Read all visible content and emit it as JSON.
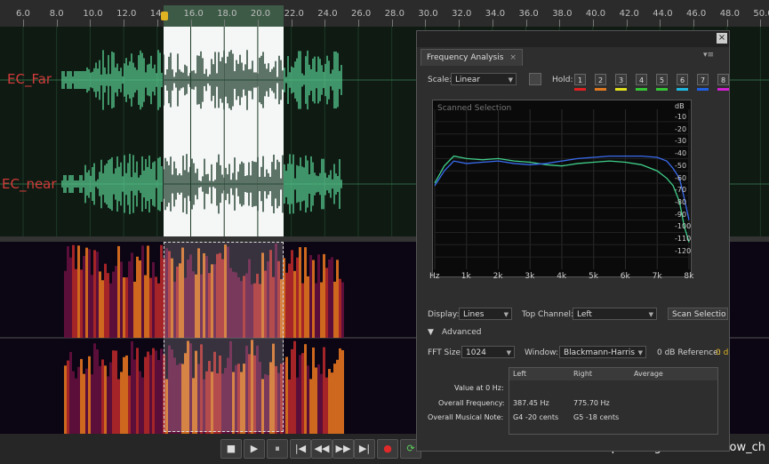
{
  "timeline": {
    "ticks": [
      "6.0",
      "8.0",
      "10.0",
      "12.0",
      "14",
      "16.0",
      "18.0",
      "20.0",
      "22.0",
      "24.0",
      "26.0",
      "28.0",
      "30.0",
      "32.0",
      "34.0",
      "36.0",
      "38.0",
      "40.0",
      "42.0",
      "44.0",
      "46.0",
      "48.0",
      "50.0"
    ]
  },
  "tracks": [
    {
      "label": "EC_Far"
    },
    {
      "label": "EC_near"
    }
  ],
  "colors": {
    "waveform": "#56c98f",
    "selection": "#f4f7f6",
    "label_red": "#d23b3b",
    "playhead": "#e0b323"
  },
  "panel": {
    "tab_title": "Frequency Analysis",
    "tab_close": "×",
    "close_icon": "×",
    "menu_icon": "▾≡",
    "scale_label": "Scale:",
    "scale_value": "Linear",
    "hold_label": "Hold:",
    "hold_buttons": [
      "1",
      "2",
      "3",
      "4",
      "5",
      "6",
      "7",
      "8"
    ],
    "hold_colors": [
      "#e02020",
      "#e07a20",
      "#e0e020",
      "#36c436",
      "#36c436",
      "#20b8e0",
      "#2060e0",
      "#d020d0"
    ],
    "graph_caption": "Scanned Selection",
    "db_unit": "dB",
    "db_ticks": [
      "-10",
      "-20",
      "-30",
      "-40",
      "-50",
      "-60",
      "-70",
      "-80",
      "-90",
      "-100",
      "-110",
      "-120"
    ],
    "freq_ticks": [
      "Hz",
      "1k",
      "2k",
      "3k",
      "4k",
      "5k",
      "6k",
      "7k",
      "8k"
    ],
    "display_label": "Display:",
    "display_value": "Lines",
    "top_channel_label": "Top Channel:",
    "top_channel_value": "Left",
    "scan_button": "Scan Selectio",
    "advanced_label": "Advanced",
    "fft_label": "FFT Size:",
    "fft_value": "1024",
    "window_label": "Window:",
    "window_value": "Blackmann-Harris",
    "zero_db_label": "0 dB Reference:",
    "zero_db_value": "0 d",
    "table": {
      "headers": [
        "Left",
        "Right",
        "Average"
      ],
      "rows": [
        {
          "label": "Value at 0 Hz:",
          "left": "",
          "right": ""
        },
        {
          "label": "Overall Frequency:",
          "left": "387.45 Hz",
          "right": "775.70 Hz"
        },
        {
          "label": "Overall Musical Note:",
          "left": "G4 -20 cents",
          "right": "G5 -18 cents"
        }
      ]
    }
  },
  "chart_data": {
    "type": "line",
    "title": "Scanned Selection",
    "xlabel": "",
    "ylabel": "dB",
    "xlim": [
      0,
      8000
    ],
    "ylim": [
      -130,
      0
    ],
    "x": [
      0,
      300,
      600,
      1000,
      1500,
      2000,
      2500,
      3000,
      3500,
      4000,
      4500,
      5000,
      5500,
      6000,
      6500,
      7000,
      7300,
      7500,
      7700,
      7850,
      8000
    ],
    "series": [
      {
        "color": "#3fd08a",
        "values": [
          -60,
          -46,
          -38,
          -40,
          -41,
          -40,
          -42,
          -43,
          -45,
          -46,
          -44,
          -43,
          -42,
          -43,
          -45,
          -50,
          -56,
          -62,
          -75,
          -95,
          -108
        ]
      },
      {
        "color": "#3a6cf0",
        "values": [
          -62,
          -50,
          -42,
          -44,
          -43,
          -42,
          -44,
          -45,
          -44,
          -42,
          -40,
          -39,
          -38,
          -38,
          -38,
          -39,
          -42,
          -48,
          -56,
          -72,
          -90
        ]
      }
    ]
  },
  "transport": {
    "buttons": [
      "■",
      "▶",
      "⏸",
      "|◀",
      "◀◀",
      "▶▶",
      "▶|",
      "●",
      "⟳"
    ],
    "watermark": "https://blog.csdn.net/crow_ch"
  }
}
